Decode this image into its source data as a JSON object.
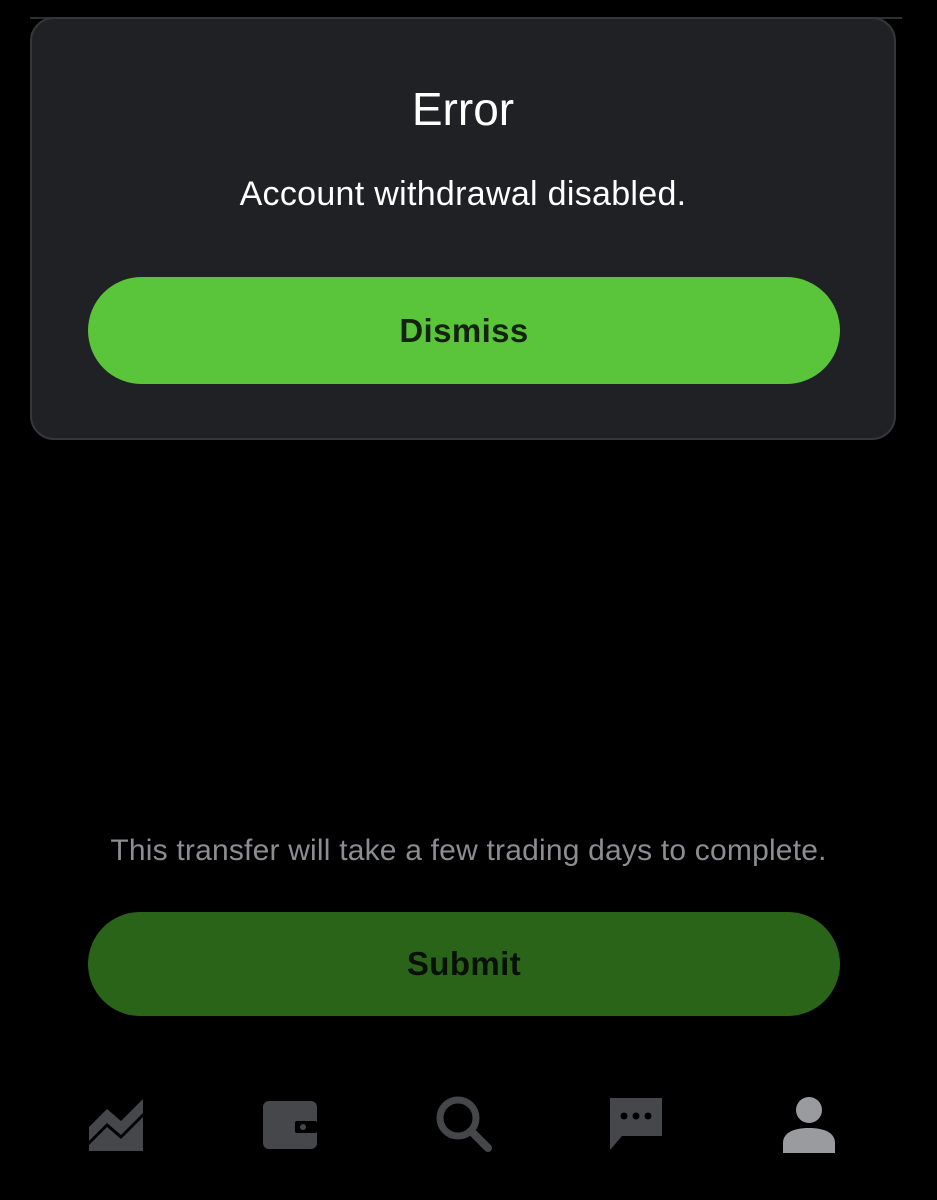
{
  "modal": {
    "title": "Error",
    "message": "Account withdrawal disabled.",
    "dismiss_label": "Dismiss"
  },
  "transfer": {
    "note": "This transfer will take a few trading days to complete.",
    "submit_label": "Submit"
  },
  "tabbar": {
    "items": [
      {
        "icon": "chart-icon",
        "active": false
      },
      {
        "icon": "wallet-icon",
        "active": false
      },
      {
        "icon": "search-icon",
        "active": false
      },
      {
        "icon": "messages-icon",
        "active": false
      },
      {
        "icon": "account-icon",
        "active": true
      }
    ]
  },
  "colors": {
    "background": "#000000",
    "modal_background": "#202124",
    "accent_green": "#5ac53b",
    "submit_green": "#2a6419",
    "muted_text": "#8c8d90",
    "icon_inactive": "#46474a",
    "icon_active": "#9a9b9e"
  }
}
